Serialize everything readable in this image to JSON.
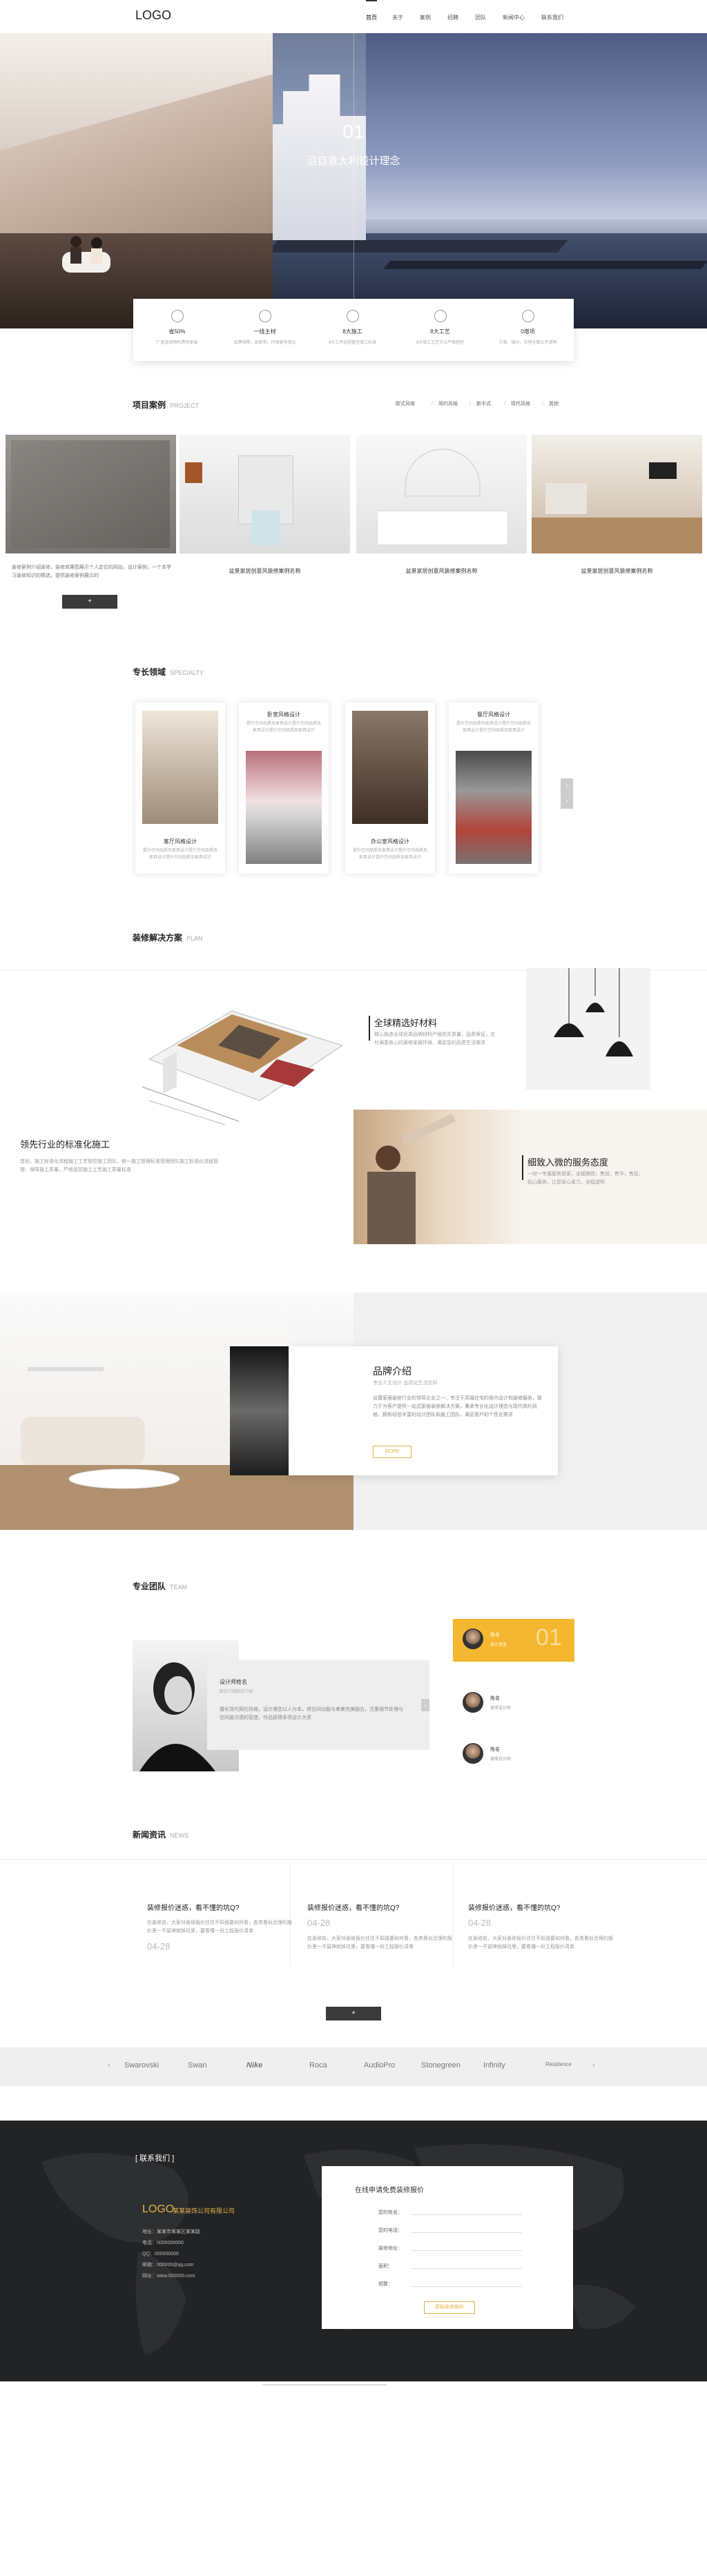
{
  "header": {
    "logo": "LOGO",
    "nav": [
      "首页",
      "关于",
      "案例",
      "招聘",
      "团队",
      "新闻中心",
      "联系我们"
    ]
  },
  "hero": {
    "slide_number": "01",
    "slide_text": "沿自意大利设计理念"
  },
  "features": [
    {
      "title": "省50%",
      "desc": "厂家直销物料费用更省"
    },
    {
      "title": "一线主材",
      "desc": "品牌保障，品质有，环保更有保证"
    },
    {
      "title": "8大施工",
      "desc": "8大工序流程管控施工标准"
    },
    {
      "title": "8大工艺",
      "desc": "8大施工工艺节点严格把控"
    },
    {
      "title": "0增项",
      "desc": "方案、报价、合同全面公开透明"
    }
  ],
  "cases": {
    "title": "项目案例",
    "subtitle": "PROJECT",
    "tabs": [
      "欧式风格",
      "简约风格",
      "新中式",
      "现代风格",
      "其他"
    ],
    "desc": "装修案例介绍装修，装修效果图展示个人定位的网站，设计案例，一个本学习装修知识的精选，提供装修案例展示的",
    "items": [
      {
        "caption": ""
      },
      {
        "caption": "盆景家居创意风装修案例名称"
      },
      {
        "caption": "盆景家居创意风装修案例名称"
      },
      {
        "caption": "盆景家居创意风装修案例名称"
      }
    ],
    "more": "+"
  },
  "specialty": {
    "title": "专长领域",
    "subtitle": "SPECIALTY",
    "cards": [
      {
        "title": "客厅风格设计",
        "desc": "提升空间品质及家具设计提升空间品质及家具设计提升空间品质及家具设计"
      },
      {
        "title": "卧室风格设计",
        "desc": "提升空间品质及家具设计提升空间品质及家具设计提升空间品质及家具设计"
      },
      {
        "title": "办公室风格设计",
        "desc": "提升空间品质及家具设计提升空间品质及家具设计提升空间品质及家具设计"
      },
      {
        "title": "餐厅风格设计",
        "desc": "提升空间品质及家具设计提升空间品质及家具设计提升空间品质及家具设计"
      }
    ],
    "arrow_prev": "‹",
    "arrow_next": "›"
  },
  "solution": {
    "title": "装修解决方案",
    "subtitle": "PLAN",
    "blocks": [
      {
        "heading": "全球精选好材料",
        "text": "精心挑选全球优质品牌材料严格把关质量，品质保证，交付满意放心的装修家居环境，满足您的品质生活需求"
      },
      {
        "heading": "领先行业的标准化施工",
        "text": "首创，施工标准化流程施工工艺管控施工团队，统一施工管理标准管理团队施工标准化流程管理，保障施工质量，严格监控施工工艺施工质量标准"
      },
      {
        "heading": "细致入微的服务态度",
        "text": "一对一专属服务管家，全程跟踪，售前，售中，售后，贴心服务，让您省心省力，全程透明"
      }
    ]
  },
  "brand": {
    "title": "品牌介绍",
    "subtitle": "专业人文设计·品质化生活空间",
    "text": "设置家居装修行业的领导企业之一，专注于高端住宅的室内设计和装修服务，致力于为客户提供一站式家居装修解决方案，秉承专业化设计理念与现代简约风格，拥有经验丰富的设计团队和施工团队，满足客户的个性化需求",
    "more": "MORE"
  },
  "team": {
    "title": "专业团队",
    "subtitle": "TEAM",
    "featured_name": "设计师姓名",
    "featured_role": "职位介绍职位介绍",
    "featured_text": "擅长现代简约风格，设计理念以人为本，将空间功能与审美完美融合，注重细节处理与空间层次感的营造，作品获得多项设计大奖",
    "number": "01",
    "members": [
      {
        "name": "姓名",
        "role": "设计总监"
      },
      {
        "name": "姓名",
        "role": "首席设计师"
      },
      {
        "name": "姓名",
        "role": "首席设计师"
      }
    ]
  },
  "news": {
    "title": "新闻资讯",
    "subtitle": "NEWS",
    "items": [
      {
        "title": "装修报价迷惑，看不懂的坑Q?",
        "date": "04-28",
        "text": "在装修前，大家对装修报价往往不知道要如何看，各类看似合理的报价里一不留神就掉坑里，要看懂一份工程报价清单"
      },
      {
        "title": "装修报价迷惑，看不懂的坑Q?",
        "date": "04-28",
        "text": "在装修前，大家对装修报价往往不知道要如何看，各类看似合理的报价里一不留神就掉坑里，要看懂一份工程报价清单"
      },
      {
        "title": "装修报价迷惑，看不懂的坑Q?",
        "date": "04-28",
        "text": "在装修前，大家对装修报价往往不知道要如何看，各类看似合理的报价里一不留神就掉坑里，要看懂一份工程报价清单"
      }
    ],
    "more": "+"
  },
  "partners": [
    "Swarovski",
    "Swan",
    "Nike",
    "Roca",
    "AudioPro",
    "Stonegreen",
    "Infinity",
    "Residence"
  ],
  "footer": {
    "contact_title": "[ 联系我们 ]",
    "logo": "LOGO",
    "company": "某某装饰公司有限公司",
    "info": [
      "地址：某某市某某区某某路",
      "电话：0000000000",
      "QQ：000000000",
      "邮箱：000000@qq.com",
      "网址：www.000000.com"
    ],
    "form_title": "在线申请免费装修报价",
    "form_fields": [
      "您的姓名：",
      "您的电话：",
      "装修地址：",
      "面积：",
      "预算："
    ],
    "form_button": "获取装修报价"
  }
}
